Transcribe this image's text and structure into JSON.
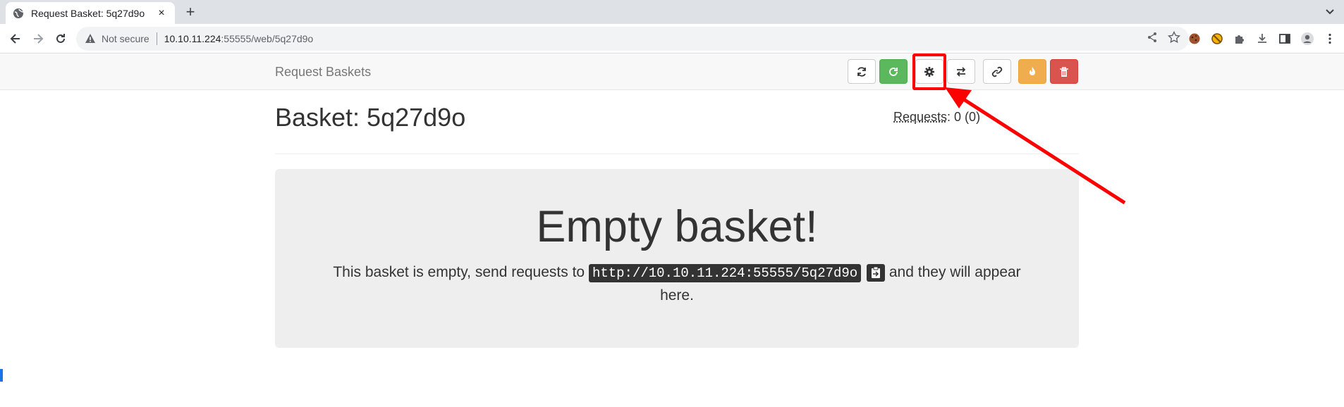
{
  "browser": {
    "tab_title": "Request Basket: 5q27d9o",
    "tab_close": "×",
    "new_tab": "+",
    "security_label": "Not secure",
    "url_host": "10.10.11.224",
    "url_rest": ":55555/web/5q27d9o"
  },
  "navbar": {
    "brand": "Request Baskets",
    "buttons": [
      {
        "name": "refresh",
        "icon": "refresh-icon"
      },
      {
        "name": "auto-refresh",
        "icon": "circular-arrow-icon",
        "color": "#5cb85c"
      },
      {
        "name": "settings",
        "icon": "gear-icon"
      },
      {
        "name": "responses",
        "icon": "exchange-icon"
      },
      {
        "name": "share",
        "icon": "link-icon"
      },
      {
        "name": "clear",
        "icon": "fire-icon",
        "color": "#f0ad4e"
      },
      {
        "name": "delete",
        "icon": "trash-icon",
        "color": "#d9534f"
      }
    ]
  },
  "basket": {
    "title": "Basket: 5q27d9o",
    "requests_label": "Requests",
    "requests_value": ": 0 (0)"
  },
  "empty": {
    "heading": "Empty basket!",
    "text_before": "This basket is empty, send requests to ",
    "url": "http://10.10.11.224:55555/5q27d9o",
    "text_after": " and they will appear here."
  },
  "annotation": {
    "color": "#ff0000"
  }
}
